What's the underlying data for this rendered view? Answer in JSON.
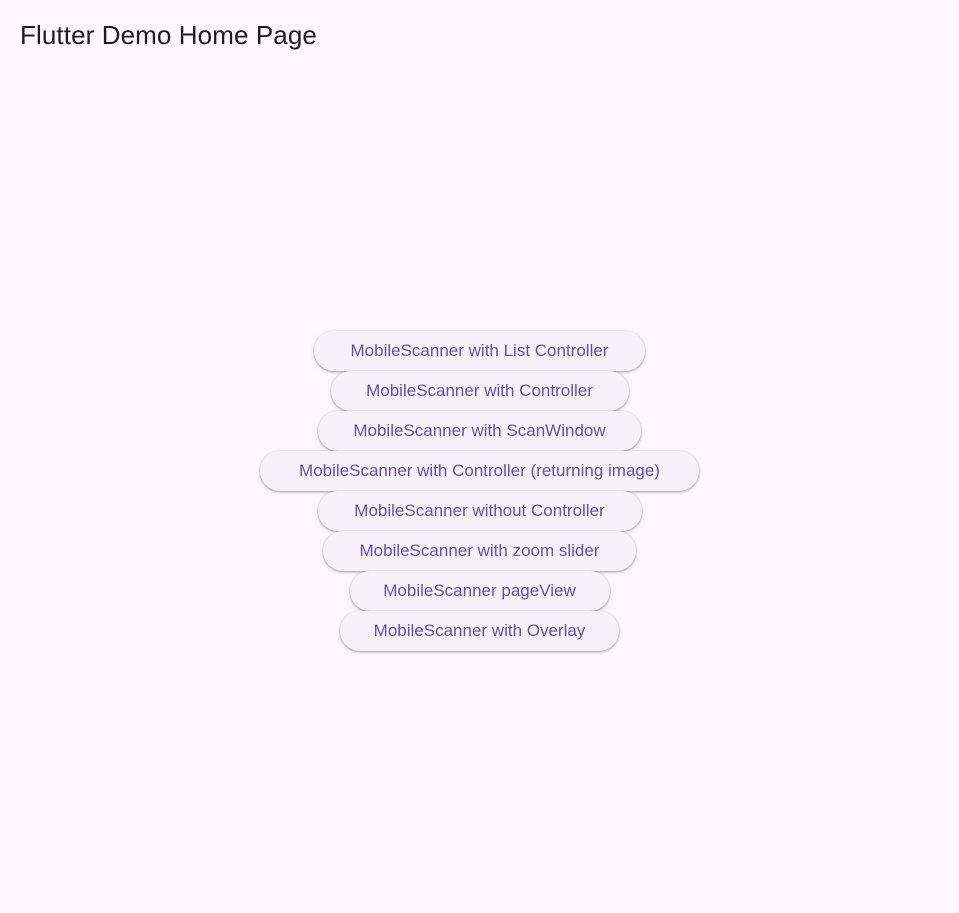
{
  "app_bar": {
    "title": "Flutter Demo Home Page"
  },
  "buttons": [
    {
      "label": "MobileScanner with List Controller"
    },
    {
      "label": "MobileScanner with Controller"
    },
    {
      "label": "MobileScanner with ScanWindow"
    },
    {
      "label": "MobileScanner with Controller (returning image)"
    },
    {
      "label": "MobileScanner without Controller"
    },
    {
      "label": "MobileScanner with zoom slider"
    },
    {
      "label": "MobileScanner pageView"
    },
    {
      "label": "MobileScanner with Overlay"
    }
  ],
  "colors": {
    "background": "#fef7ff",
    "button_surface": "#f7f2fa",
    "button_text": "#6750a4",
    "title_text": "#1d1b20"
  }
}
